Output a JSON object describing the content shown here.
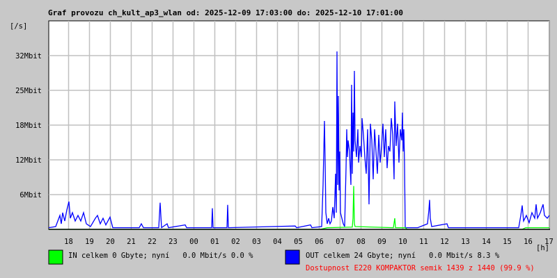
{
  "chart_data": {
    "type": "line",
    "title": "Graf provozu ch_kult_ap3_wlan od: 2025-12-09 17:03:00 do: 2025-12-10 17:01:00",
    "ylabel": "[/s]",
    "xlabel": "[h]",
    "x_unit": "minutes since 17:03",
    "xlim": [
      0,
      1438
    ],
    "ylim": [
      0,
      37.5
    ],
    "grid": true,
    "y_ticks": [
      {
        "value": 6.25,
        "label": "6Mbit"
      },
      {
        "value": 12.5,
        "label": "12Mbit"
      },
      {
        "value": 18.75,
        "label": "18Mbit"
      },
      {
        "value": 25,
        "label": "25Mbit"
      },
      {
        "value": 31.25,
        "label": "32Mbit"
      }
    ],
    "x_ticks": [
      "18",
      "19",
      "20",
      "21",
      "22",
      "23",
      "00",
      "01",
      "02",
      "03",
      "04",
      "05",
      "06",
      "07",
      "08",
      "09",
      "10",
      "11",
      "12",
      "13",
      "14",
      "15",
      "16",
      "17"
    ],
    "series": [
      {
        "name": "OUT",
        "color": "#0000ff",
        "points": [
          [
            0,
            0.3
          ],
          [
            20,
            0.5
          ],
          [
            32,
            2.5
          ],
          [
            36,
            1
          ],
          [
            40,
            3
          ],
          [
            46,
            1.5
          ],
          [
            52,
            3.5
          ],
          [
            58,
            5
          ],
          [
            62,
            2
          ],
          [
            68,
            3
          ],
          [
            76,
            1.5
          ],
          [
            84,
            2.5
          ],
          [
            92,
            1.5
          ],
          [
            100,
            3
          ],
          [
            108,
            1
          ],
          [
            120,
            0.5
          ],
          [
            134,
            2
          ],
          [
            140,
            2.5
          ],
          [
            148,
            1
          ],
          [
            156,
            2
          ],
          [
            164,
            0.8
          ],
          [
            176,
            2.2
          ],
          [
            184,
            0.3
          ],
          [
            260,
            0.3
          ],
          [
            266,
            1
          ],
          [
            272,
            0.3
          ],
          [
            316,
            0.3
          ],
          [
            320,
            4.8
          ],
          [
            324,
            0.3
          ],
          [
            340,
            1
          ],
          [
            344,
            0.3
          ],
          [
            392,
            0.8
          ],
          [
            396,
            0.3
          ],
          [
            468,
            0.3
          ],
          [
            470,
            3.8
          ],
          [
            472,
            0.3
          ],
          [
            512,
            0.3
          ],
          [
            514,
            4.4
          ],
          [
            516,
            0.3
          ],
          [
            708,
            0.6
          ],
          [
            712,
            0.3
          ],
          [
            752,
            0.8
          ],
          [
            756,
            0.3
          ],
          [
            784,
            0.5
          ],
          [
            788,
            8
          ],
          [
            792,
            19.5
          ],
          [
            794,
            12
          ],
          [
            796,
            3
          ],
          [
            800,
            1
          ],
          [
            804,
            2
          ],
          [
            808,
            1
          ],
          [
            812,
            1.5
          ],
          [
            816,
            4
          ],
          [
            820,
            2
          ],
          [
            824,
            10
          ],
          [
            826,
            3
          ],
          [
            828,
            32
          ],
          [
            830,
            8
          ],
          [
            832,
            24
          ],
          [
            834,
            7
          ],
          [
            836,
            14
          ],
          [
            838,
            3
          ],
          [
            842,
            2
          ],
          [
            846,
            1
          ],
          [
            850,
            0.5
          ],
          [
            854,
            11
          ],
          [
            856,
            18
          ],
          [
            858,
            13
          ],
          [
            860,
            16
          ],
          [
            864,
            14
          ],
          [
            868,
            8
          ],
          [
            870,
            26
          ],
          [
            872,
            10
          ],
          [
            874,
            21
          ],
          [
            876,
            14
          ],
          [
            878,
            28.5
          ],
          [
            880,
            16
          ],
          [
            884,
            13
          ],
          [
            888,
            18
          ],
          [
            890,
            12
          ],
          [
            894,
            15
          ],
          [
            898,
            13
          ],
          [
            900,
            20
          ],
          [
            904,
            17
          ],
          [
            908,
            13
          ],
          [
            912,
            10
          ],
          [
            916,
            18
          ],
          [
            920,
            4.5
          ],
          [
            922,
            12
          ],
          [
            924,
            19
          ],
          [
            928,
            16
          ],
          [
            932,
            9
          ],
          [
            936,
            18
          ],
          [
            940,
            14
          ],
          [
            944,
            10
          ],
          [
            948,
            17
          ],
          [
            952,
            12
          ],
          [
            956,
            15
          ],
          [
            960,
            19
          ],
          [
            964,
            13
          ],
          [
            968,
            18
          ],
          [
            972,
            11
          ],
          [
            976,
            15
          ],
          [
            980,
            14
          ],
          [
            984,
            20
          ],
          [
            988,
            17
          ],
          [
            992,
            9
          ],
          [
            994,
            23
          ],
          [
            998,
            15
          ],
          [
            1002,
            19
          ],
          [
            1006,
            12
          ],
          [
            1010,
            18
          ],
          [
            1014,
            16
          ],
          [
            1016,
            21
          ],
          [
            1018,
            14
          ],
          [
            1020,
            18
          ],
          [
            1022,
            12
          ],
          [
            1024,
            0.3
          ],
          [
            1060,
            0.3
          ],
          [
            1088,
            1
          ],
          [
            1092,
            3.5
          ],
          [
            1094,
            5.3
          ],
          [
            1096,
            2
          ],
          [
            1100,
            0.5
          ],
          [
            1144,
            1
          ],
          [
            1148,
            0.3
          ],
          [
            1350,
            0.3
          ],
          [
            1356,
            2.5
          ],
          [
            1360,
            4.3
          ],
          [
            1364,
            1.5
          ],
          [
            1372,
            2.5
          ],
          [
            1380,
            1.2
          ],
          [
            1388,
            3
          ],
          [
            1396,
            2
          ],
          [
            1400,
            4.5
          ],
          [
            1404,
            2
          ],
          [
            1412,
            3
          ],
          [
            1420,
            4.5
          ],
          [
            1424,
            2.5
          ],
          [
            1432,
            2
          ],
          [
            1438,
            2.5
          ]
        ]
      },
      {
        "name": "IN",
        "color": "#00ff00",
        "points": [
          [
            0,
            0
          ],
          [
            780,
            0
          ],
          [
            800,
            0.3
          ],
          [
            872,
            0.4
          ],
          [
            874,
            2
          ],
          [
            876,
            7.8
          ],
          [
            878,
            1
          ],
          [
            880,
            0.5
          ],
          [
            990,
            0.3
          ],
          [
            994,
            2
          ],
          [
            996,
            0.3
          ],
          [
            1024,
            0.3
          ],
          [
            1030,
            0
          ],
          [
            1360,
            0
          ],
          [
            1370,
            0.3
          ],
          [
            1438,
            0.3
          ]
        ]
      }
    ],
    "legend": [
      {
        "name": "IN",
        "color": "#00ff00",
        "text": "IN celkem 0 Gbyte; nyní   0.0 Mbit/s 0.0 %"
      },
      {
        "name": "OUT",
        "color": "#0000ff",
        "text": "OUT celkem 24 Gbyte; nyní   0.0 Mbit/s 8.3 %"
      }
    ],
    "availability": "Dostupnost E220 KOMPAKTOR semik 1439 z 1440 (99.9 %)",
    "availability_color": "#ff0000"
  }
}
